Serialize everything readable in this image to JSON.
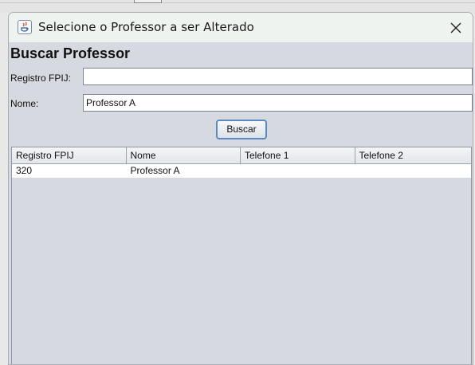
{
  "window": {
    "title": "Selecione o Professor a ser Alterado",
    "close_icon": "close-icon"
  },
  "form": {
    "heading": "Buscar Professor",
    "registro_label": "Registro FPIJ:",
    "registro_value": "",
    "nome_label": "Nome:",
    "nome_value": "Professor A",
    "search_button": "Buscar"
  },
  "table": {
    "columns": [
      "Registro FPIJ",
      "Nome",
      "Telefone 1",
      "Telefone 2"
    ],
    "rows": [
      [
        "320",
        "Professor A",
        "",
        ""
      ]
    ]
  },
  "colors": {
    "window_bg": "#d6d9df",
    "titlebar_bg": "#eef3f0",
    "button_border": "#5a8ac0"
  }
}
